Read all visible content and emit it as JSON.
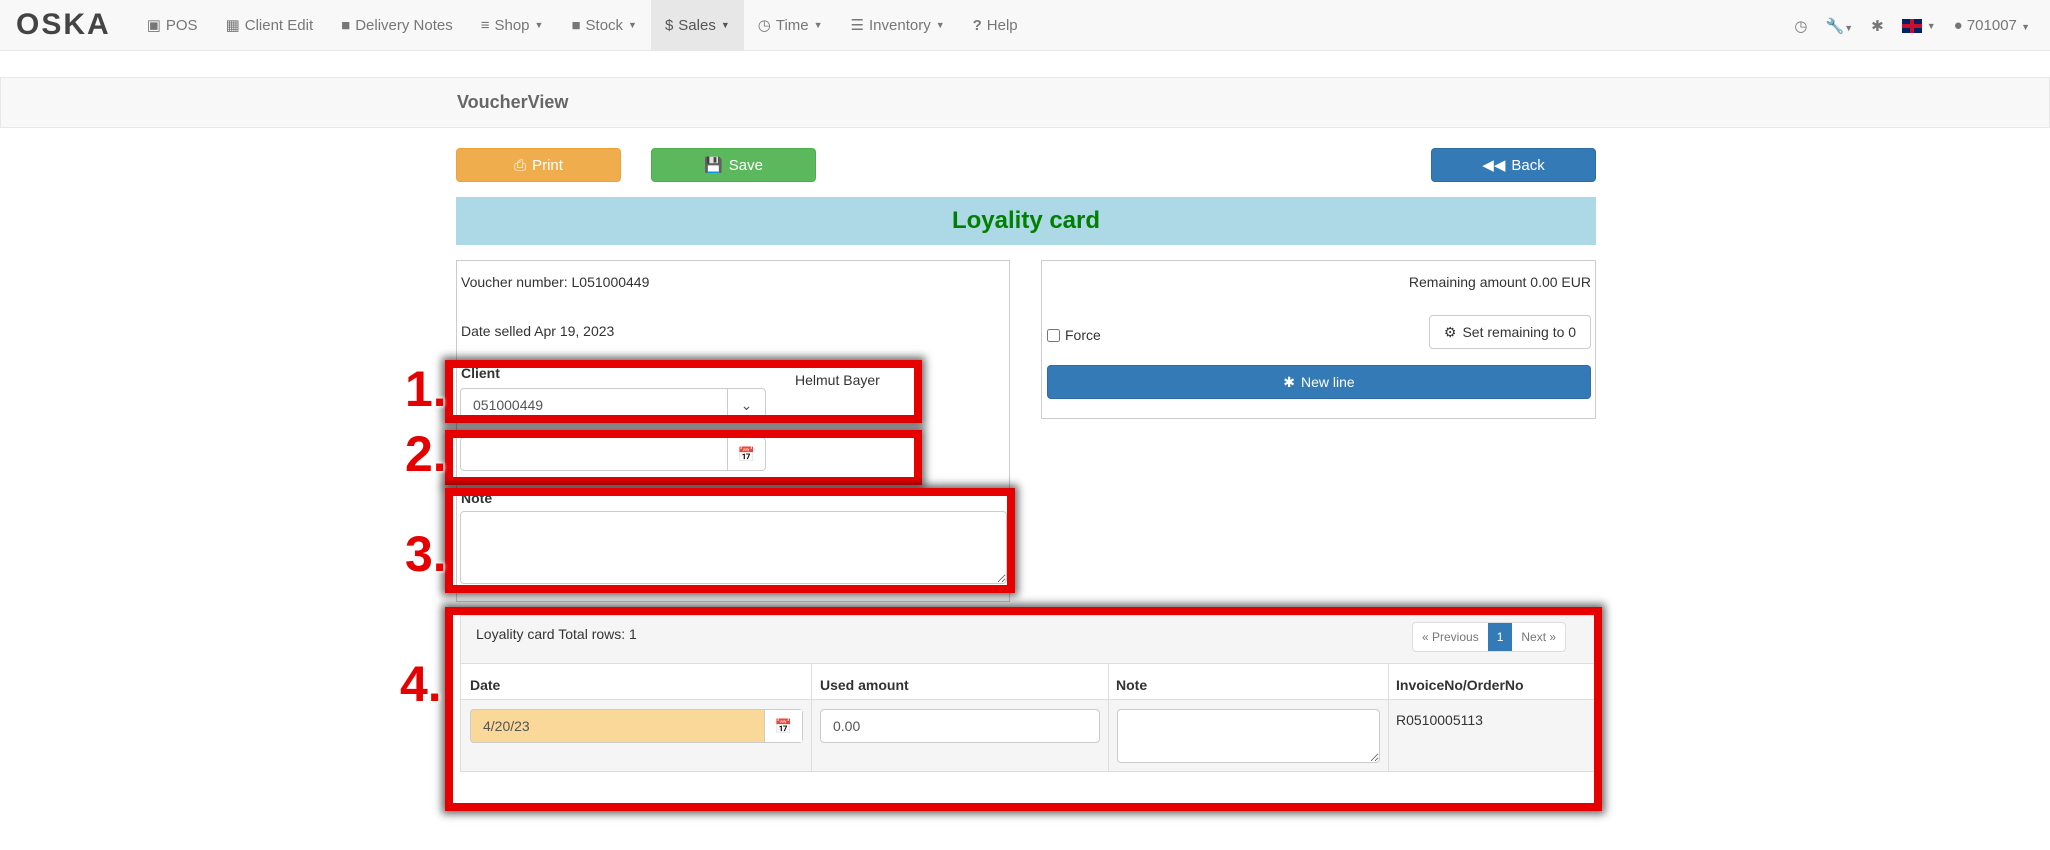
{
  "nav": {
    "brand": "OSKA",
    "items": [
      {
        "label": "POS",
        "icon": "shopping-bag-icon"
      },
      {
        "label": "Client Edit",
        "icon": "contact-card-icon"
      },
      {
        "label": "Delivery Notes",
        "icon": "archive-icon"
      },
      {
        "label": "Shop",
        "icon": "sliders-icon",
        "dropdown": true
      },
      {
        "label": "Stock",
        "icon": "archive-icon",
        "dropdown": true
      },
      {
        "label": "Sales",
        "icon": "dollar-icon",
        "dropdown": true,
        "active": true
      },
      {
        "label": "Time",
        "icon": "clock-icon",
        "dropdown": true
      },
      {
        "label": "Inventory",
        "icon": "list-icon",
        "dropdown": true
      },
      {
        "label": "Help",
        "icon": "question-icon"
      }
    ],
    "user": "701007"
  },
  "page_title": "VoucherView",
  "buttons": {
    "print": "Print",
    "save": "Save",
    "back": "Back"
  },
  "colors": {
    "print": "#f0ad4e",
    "save": "#5cb85c",
    "primary": "#337ab7",
    "banner_bg": "#add8e6",
    "banner_text": "#008000",
    "highlight": "#e60000"
  },
  "banner": "Loyality card",
  "voucher": {
    "number_text": "Voucher number: L051000449",
    "date_sold_text": "Date selled Apr 19, 2023",
    "client_label": "Client",
    "client_value": "051000449",
    "client_name": "Helmut Bayer",
    "date_value": "",
    "note_label": "Note",
    "note_value": ""
  },
  "right": {
    "remaining": "Remaining amount 0.00 EUR",
    "force_label": "Force",
    "force_checked": false,
    "set_remaining": "Set remaining to 0",
    "new_line": "New line"
  },
  "annotations": [
    "1.",
    "2.",
    "3.",
    "4."
  ],
  "table": {
    "caption": "Loyality card Total rows: 1",
    "pagination": {
      "prev": "« Previous",
      "page": "1",
      "next": "Next »"
    },
    "columns": [
      "Date",
      "Used amount",
      "Note",
      "InvoiceNo/OrderNo"
    ],
    "rows": [
      {
        "date": "4/20/23",
        "used_amount": "0.00",
        "note": "",
        "invoice": "R0510005113"
      }
    ]
  }
}
